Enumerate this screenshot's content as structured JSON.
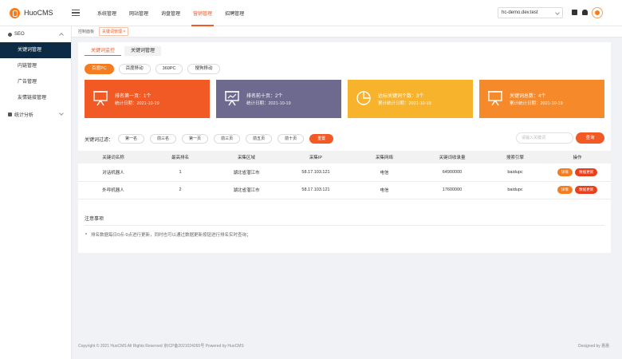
{
  "app": {
    "name": "HuoCMS"
  },
  "topnav": [
    {
      "label": "系统管理",
      "active": false
    },
    {
      "label": "网站管理",
      "active": false
    },
    {
      "label": "询盘管理",
      "active": false
    },
    {
      "label": "营销管理",
      "active": true
    },
    {
      "label": "招聘管理",
      "active": false
    }
  ],
  "site_select": {
    "value": "hc-demo.dev.test"
  },
  "sidebar": {
    "group_seo": "SEO",
    "items": [
      "关键词管理",
      "内链管理",
      "广告管理",
      "友情链接管理"
    ],
    "group_stats": "统计分析"
  },
  "breadcrumb": {
    "home": "控制面板",
    "current": "关键词管理 ×"
  },
  "subtabs": [
    "关键词监控",
    "关键词管理"
  ],
  "engines": [
    "百度PC",
    "百度移动",
    "360PC",
    "搜狗移动"
  ],
  "cards": [
    {
      "title": "排名第一页：1个",
      "date": "统计日期：2021-10-19",
      "color": "#f15a24",
      "icon": "presentation-board-icon"
    },
    {
      "title": "排名前十页：2个",
      "date": "统计日期：2021-10-19",
      "color": "#6e6a8f",
      "icon": "chart-board-icon"
    },
    {
      "title": "达标关键词个数：3个",
      "date": "累计统计日期：2021-10-19",
      "color": "#f7b32b",
      "icon": "pie-chart-icon"
    },
    {
      "title": "关键词总数：4个",
      "date": "累计统计日期：2021-10-19",
      "color": "#f68a2a",
      "icon": "presentation-board-icon"
    }
  ],
  "filter": {
    "label": "关键词过滤：",
    "buttons": [
      "第一名",
      "前三名",
      "第一页",
      "前三页",
      "前五页",
      "前十页",
      "重置"
    ]
  },
  "search": {
    "placeholder": "请输入关键词",
    "button": "查询"
  },
  "table": {
    "headers": [
      "关键词名称",
      "最高排名",
      "采集区域",
      "采集IP",
      "采集网络",
      "关键词收录量",
      "搜索引擎",
      "操作"
    ],
    "rows": [
      [
        "对话机器人",
        "1",
        "湖北省潜江市",
        "58.17.103.121",
        "电信",
        "64900000",
        "baidupc"
      ],
      [
        "外呼机器人",
        "2",
        "湖北省潜江市",
        "58.17.103.121",
        "电信",
        "17600000",
        "baidupc"
      ]
    ],
    "actions": {
      "detail": "详情",
      "update": "数据更新"
    }
  },
  "notes": {
    "title": "注意事项",
    "item": "排名数据每日0点-9点进行更新，同时也可以通过数据更新按钮进行排名实时查询；"
  },
  "footer": {
    "left": "Copyright © 2021 HuoCMS All Rights Reserved 京ICP备2021024265号 Powered by HuoCMS",
    "right": "Designed by 惠惠"
  }
}
